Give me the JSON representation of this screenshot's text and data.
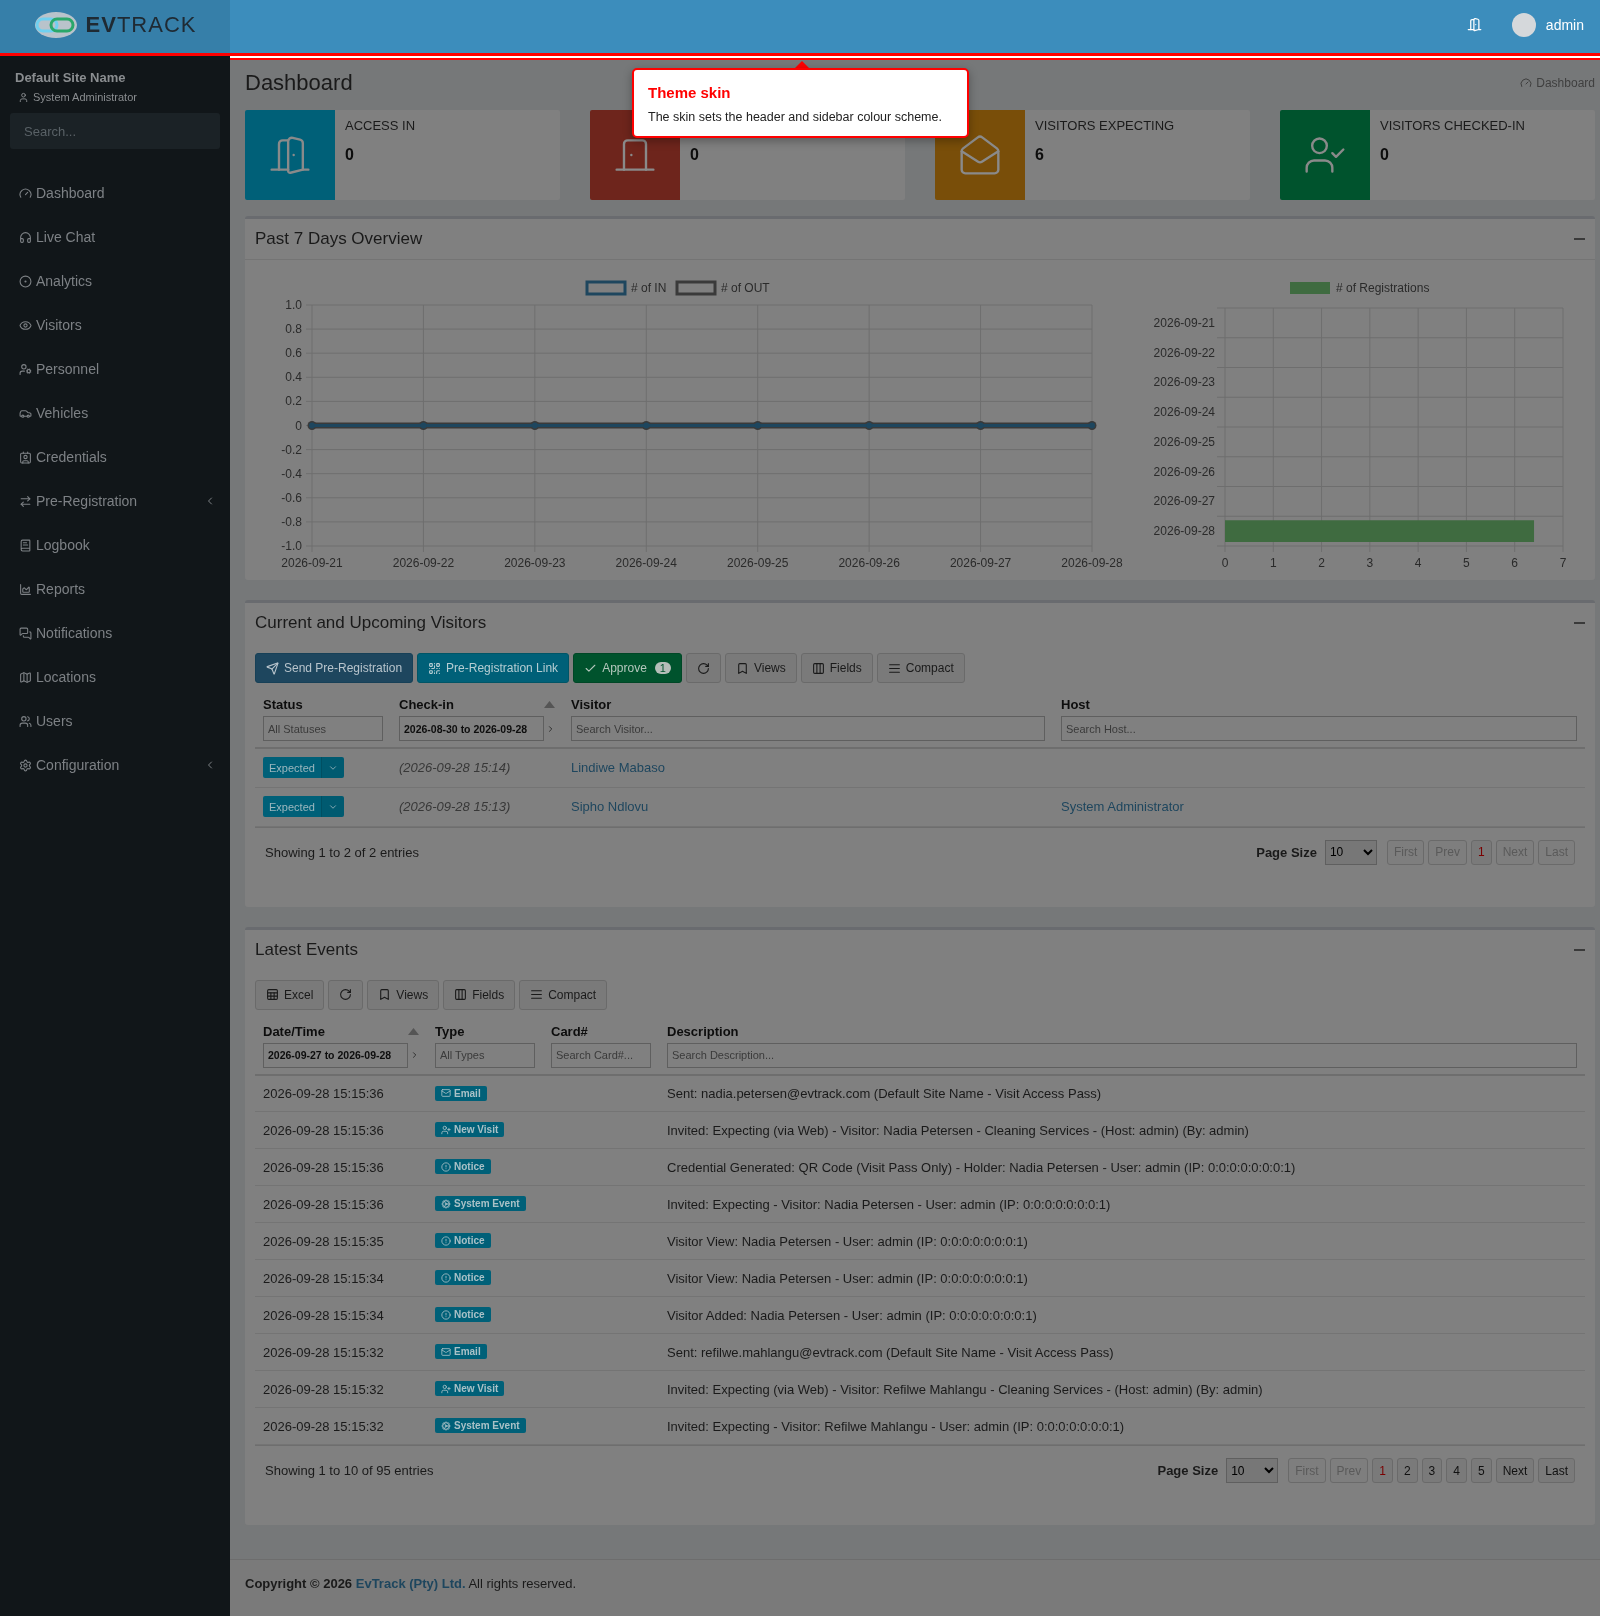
{
  "header": {
    "logo_text": "**EV**TRACK",
    "user": "admin"
  },
  "sidebar": {
    "site_name": "Default Site Name",
    "role": "System Administrator",
    "search": {
      "placeholder": "Search..."
    },
    "items": [
      {
        "label": "Dashboard",
        "expandable": false
      },
      {
        "label": "Live Chat",
        "expandable": false
      },
      {
        "label": "Analytics",
        "expandable": false
      },
      {
        "label": "Visitors",
        "expandable": false
      },
      {
        "label": "Personnel",
        "expandable": false
      },
      {
        "label": "Vehicles",
        "expandable": false
      },
      {
        "label": "Credentials",
        "expandable": false
      },
      {
        "label": "Pre-Registration",
        "expandable": true
      },
      {
        "label": "Logbook",
        "expandable": false
      },
      {
        "label": "Reports",
        "expandable": false
      },
      {
        "label": "Notifications",
        "expandable": false
      },
      {
        "label": "Locations",
        "expandable": false
      },
      {
        "label": "Users",
        "expandable": false
      },
      {
        "label": "Configuration",
        "expandable": true
      }
    ]
  },
  "page": {
    "title": "Dashboard",
    "breadcrumb": "Dashboard"
  },
  "tooltip": {
    "title": "Theme skin",
    "text": "The skin sets the header and sidebar colour scheme."
  },
  "info_boxes": [
    {
      "kind": "access-in",
      "label": "ACCESS IN",
      "value": "0",
      "color": "#006078"
    },
    {
      "kind": "access-out",
      "value": "0",
      "color": "#6e251c"
    },
    {
      "kind": "expecting",
      "label": "VISITORS EXPECTING",
      "value": "6",
      "color": "#794e09"
    },
    {
      "kind": "checked-in",
      "label": "VISITORS CHECKED-IN",
      "value": "0",
      "color": "#00532d"
    }
  ],
  "overview": {
    "title": "Past 7 Days Overview",
    "line_chart": {
      "chart_data": {
        "type": "line",
        "grid": true,
        "legend": true,
        "categories": [
          "2026-09-21",
          "2026-09-22",
          "2026-09-23",
          "2026-09-24",
          "2026-09-25",
          "2026-09-26",
          "2026-09-27",
          "2026-09-28"
        ],
        "ylim": [
          -1,
          1
        ],
        "yticks": [
          {
            "value": 1,
            "label": "1.0"
          },
          0.8,
          0.6,
          0.4,
          0.2,
          0,
          -0.2,
          -0.4,
          -0.6,
          -0.8,
          {
            "value": -1,
            "label": "-1.0"
          }
        ],
        "series": [
          {
            "name": "# of IN",
            "color": "#1e465e",
            "marker": "circle",
            "values": [
              0,
              0,
              0,
              0,
              0,
              0,
              0,
              0
            ]
          },
          {
            "name": "# of OUT",
            "color": "#3a3a3a",
            "marker": "circle",
            "values": [
              0,
              0,
              0,
              0,
              0,
              0,
              0,
              0
            ]
          }
        ]
      }
    },
    "bar_chart": {
      "chart_data": {
        "type": "bar",
        "orientation": "horizontal",
        "grid": true,
        "legend": true,
        "categories": [
          "2026-09-21",
          "2026-09-22",
          "2026-09-23",
          "2026-09-24",
          "2026-09-25",
          "2026-09-26",
          "2026-09-27",
          "2026-09-28"
        ],
        "xlim": [
          0,
          7
        ],
        "xticks": [
          0,
          1,
          2,
          3,
          4,
          5,
          6,
          7
        ],
        "series": [
          {
            "name": "# of Registrations",
            "color": "#3f6b40",
            "values": [
              0,
              0,
              0,
              0,
              0,
              0,
              0,
              6.4
            ]
          }
        ]
      }
    }
  },
  "visitors": {
    "title": "Current and Upcoming Visitors",
    "toolbar": [
      {
        "kind": "send",
        "label": "Send Pre-Registration"
      },
      {
        "kind": "link",
        "label": "Pre-Registration Link"
      },
      {
        "kind": "approve",
        "label": "Approve",
        "count": "1"
      },
      {
        "kind": "refresh"
      },
      {
        "kind": "views",
        "label": "Views"
      },
      {
        "kind": "fields",
        "label": "Fields"
      },
      {
        "kind": "compact",
        "label": "Compact"
      }
    ],
    "columns": [
      {
        "label": "Status",
        "sorted": false,
        "filter": {
          "placeholder": "All Statuses"
        }
      },
      {
        "label": "Check-in",
        "sorted": true,
        "filter": {
          "value": "2026-08-30 to 2026-09-28"
        }
      },
      {
        "label": "Visitor",
        "sorted": false,
        "filter": {
          "placeholder": "Search Visitor..."
        }
      },
      {
        "label": "Host",
        "sorted": false,
        "filter": {
          "placeholder": "Search Host..."
        }
      }
    ],
    "rows": [
      {
        "status": "Expected",
        "check_in": "(2026-09-28 15:14)",
        "visitor": "Lindiwe Mabaso"
      },
      {
        "status": "Expected",
        "check_in": "(2026-09-28 15:13)",
        "visitor": "Sipho Ndlovu",
        "host": "System Administrator"
      }
    ],
    "summary": "Showing 1 to 2 of 2 entries",
    "pager": {
      "page_size_label": "Page Size",
      "page_size": "10",
      "buttons": [
        {
          "label": "First",
          "disabled": true,
          "selected": false
        },
        {
          "label": "Prev",
          "disabled": true,
          "selected": false
        },
        {
          "label": "1",
          "disabled": false,
          "selected": true
        },
        {
          "label": "Next",
          "disabled": true,
          "selected": false
        },
        {
          "label": "Last",
          "disabled": true,
          "selected": false
        }
      ]
    }
  },
  "events": {
    "title": "Latest Events",
    "toolbar": [
      {
        "kind": "excel",
        "label": "Excel"
      },
      {
        "kind": "refresh"
      },
      {
        "kind": "views",
        "label": "Views"
      },
      {
        "kind": "fields",
        "label": "Fields"
      },
      {
        "kind": "compact",
        "label": "Compact"
      }
    ],
    "columns": [
      {
        "label": "Date/Time",
        "sorted": true,
        "filter": {
          "value": "2026-09-27 to 2026-09-28"
        }
      },
      {
        "label": "Type",
        "sorted": false,
        "filter": {
          "placeholder": "All Types"
        }
      },
      {
        "label": "Card#",
        "sorted": false,
        "filter": {
          "placeholder": "Search Card#..."
        }
      },
      {
        "label": "Description",
        "sorted": false,
        "filter": {
          "placeholder": "Search Description..."
        }
      }
    ],
    "rows": [
      {
        "time": "2026-09-28 15:15:36",
        "type": {
          "kind": "email",
          "label": "Email"
        },
        "description": "Sent: nadia.petersen@evtrack.com (Default Site Name - Visit Access Pass)"
      },
      {
        "time": "2026-09-28 15:15:36",
        "type": {
          "kind": "new-visit",
          "label": "New Visit"
        },
        "description": "Invited: Expecting (via Web) - Visitor: Nadia Petersen - Cleaning Services - (Host: admin) (By: admin)"
      },
      {
        "time": "2026-09-28 15:15:36",
        "type": {
          "kind": "notice",
          "label": "Notice"
        },
        "description": "Credential Generated: QR Code (Visit Pass Only) - Holder: Nadia Petersen - User: admin (IP: 0:0:0:0:0:0:0:1)"
      },
      {
        "time": "2026-09-28 15:15:36",
        "type": {
          "kind": "system-event",
          "label": "System Event"
        },
        "description": "Invited: Expecting - Visitor: Nadia Petersen - User: admin (IP: 0:0:0:0:0:0:0:1)"
      },
      {
        "time": "2026-09-28 15:15:35",
        "type": {
          "kind": "notice",
          "label": "Notice"
        },
        "description": "Visitor View: Nadia Petersen - User: admin (IP: 0:0:0:0:0:0:0:1)"
      },
      {
        "time": "2026-09-28 15:15:34",
        "type": {
          "kind": "notice",
          "label": "Notice"
        },
        "description": "Visitor View: Nadia Petersen - User: admin (IP: 0:0:0:0:0:0:0:1)"
      },
      {
        "time": "2026-09-28 15:15:34",
        "type": {
          "kind": "notice",
          "label": "Notice"
        },
        "description": "Visitor Added: Nadia Petersen - User: admin (IP: 0:0:0:0:0:0:0:1)"
      },
      {
        "time": "2026-09-28 15:15:32",
        "type": {
          "kind": "email",
          "label": "Email"
        },
        "description": "Sent: refilwe.mahlangu@evtrack.com (Default Site Name - Visit Access Pass)"
      },
      {
        "time": "2026-09-28 15:15:32",
        "type": {
          "kind": "new-visit",
          "label": "New Visit"
        },
        "description": "Invited: Expecting (via Web) - Visitor: Refilwe Mahlangu - Cleaning Services - (Host: admin) (By: admin)"
      },
      {
        "time": "2026-09-28 15:15:32",
        "type": {
          "kind": "system-event",
          "label": "System Event"
        },
        "description": "Invited: Expecting - Visitor: Refilwe Mahlangu - User: admin (IP: 0:0:0:0:0:0:0:1)"
      }
    ],
    "summary": "Showing 1 to 10 of 95 entries",
    "pager": {
      "page_size_label": "Page Size",
      "page_size": "10",
      "buttons": [
        {
          "label": "First",
          "disabled": true,
          "selected": false
        },
        {
          "label": "Prev",
          "disabled": true,
          "selected": false
        },
        {
          "label": "1",
          "disabled": false,
          "selected": true
        },
        {
          "label": "2",
          "disabled": false,
          "selected": false
        },
        {
          "label": "3",
          "disabled": false,
          "selected": false
        },
        {
          "label": "4",
          "disabled": false,
          "selected": false
        },
        {
          "label": "5",
          "disabled": false,
          "selected": false
        },
        {
          "label": "Next",
          "disabled": false,
          "selected": false
        },
        {
          "label": "Last",
          "disabled": false,
          "selected": false
        }
      ]
    }
  },
  "footer": {
    "prefix": "Copyright © 2026",
    "link": "EvTrack (Pty) Ltd.",
    "suffix": "All rights reserved."
  }
}
